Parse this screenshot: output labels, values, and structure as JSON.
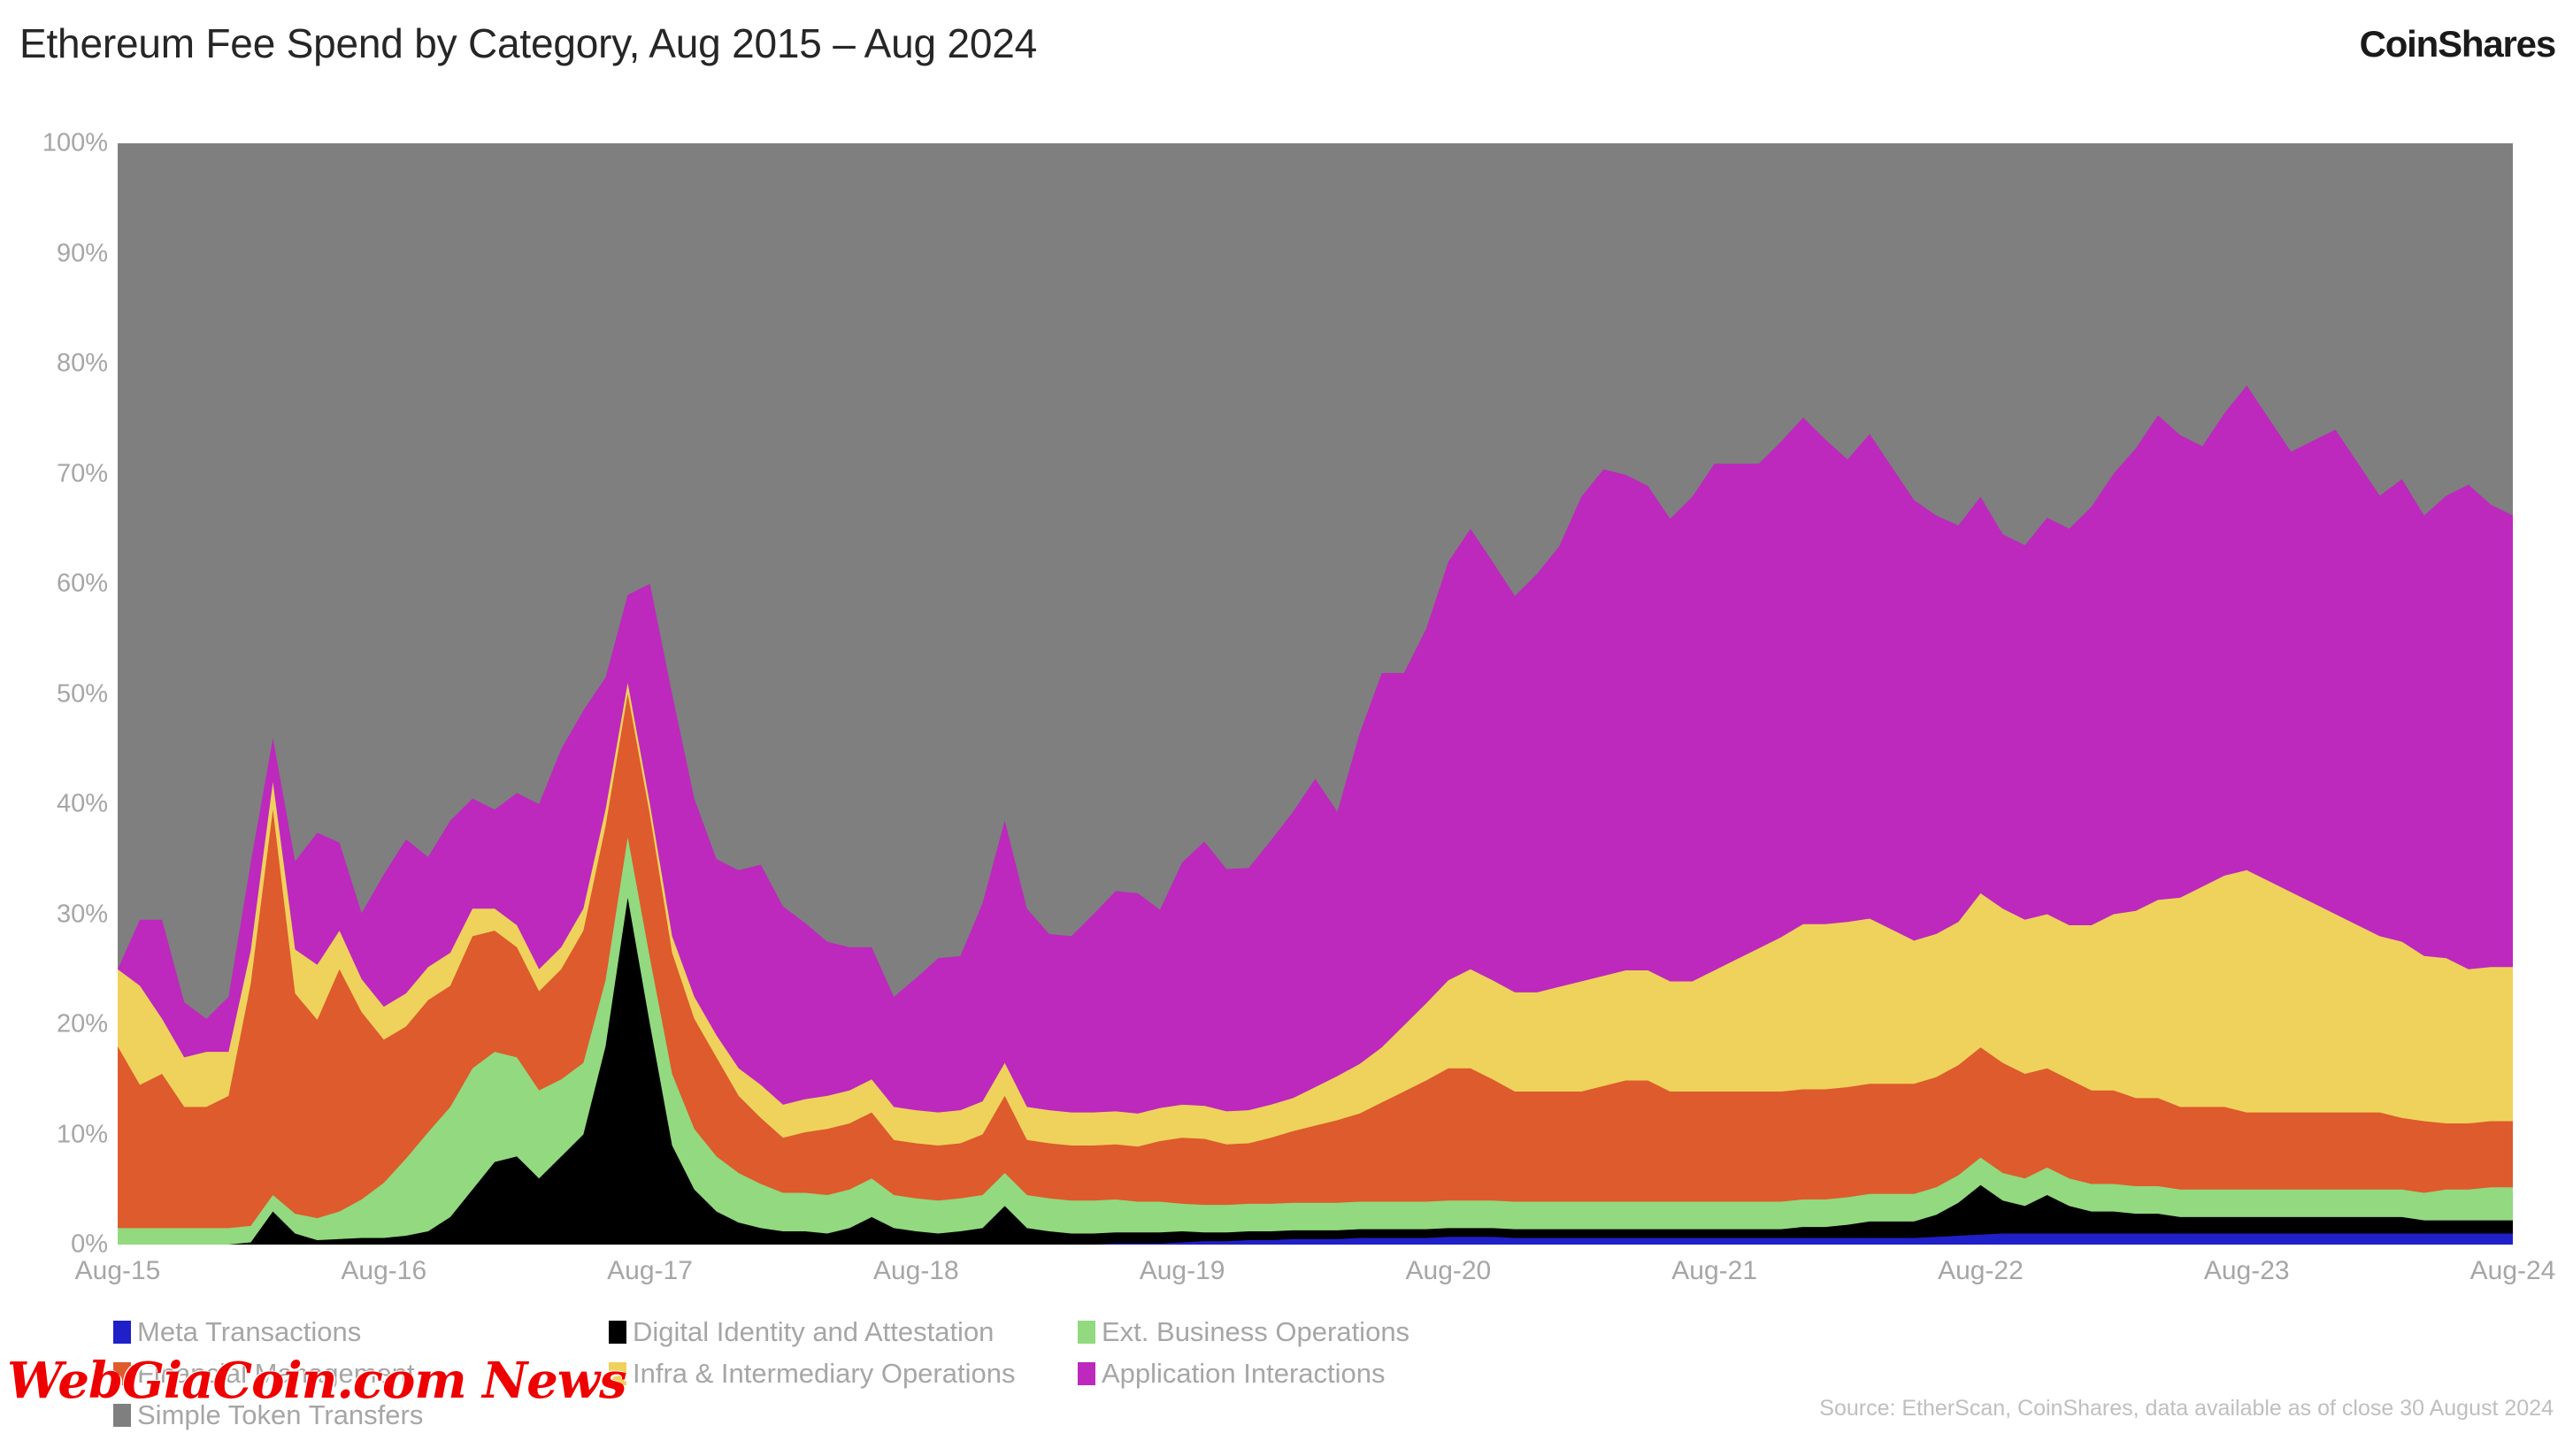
{
  "header": {
    "title": "Ethereum Fee Spend by Category, Aug 2015 – Aug 2024",
    "brand": "CoinShares"
  },
  "footer": {
    "source": "Source: EtherScan, CoinShares, data available as of close 30 August 2024",
    "watermark": "WebGiaCoin.com News"
  },
  "legend": {
    "items": [
      {
        "label": "Meta Transactions",
        "color": "#2020C8"
      },
      {
        "label": "Digital Identity and Attestation",
        "color": "#000000"
      },
      {
        "label": "Ext. Business Operations",
        "color": "#92D97F"
      },
      {
        "label": "Financial Management",
        "color": "#DD5B2C"
      },
      {
        "label": "Infra & Intermediary Operations",
        "color": "#EFD25C"
      },
      {
        "label": "Application Interactions",
        "color": "#BC29BC"
      },
      {
        "label": "Simple Token Transfers",
        "color": "#7F7F7F"
      }
    ]
  },
  "chart_data": {
    "type": "area",
    "stacked": true,
    "normalized": true,
    "title": "Ethereum Fee Spend by Category, Aug 2015 – Aug 2024",
    "xlabel": "",
    "ylabel": "",
    "ylim": [
      0,
      100
    ],
    "ytick_labels": [
      "100%",
      "90%",
      "80%",
      "70%",
      "60%",
      "50%",
      "40%",
      "30%",
      "20%",
      "10%",
      "0%"
    ],
    "ytick_values": [
      100,
      90,
      80,
      70,
      60,
      50,
      40,
      30,
      20,
      10,
      0
    ],
    "xtick_labels": [
      "Aug-15",
      "Aug-16",
      "Aug-17",
      "Aug-18",
      "Aug-19",
      "Aug-20",
      "Aug-21",
      "Aug-22",
      "Aug-23",
      "Aug-24"
    ],
    "grid": false,
    "legend_position": "bottom-left",
    "plot_background": "#7F7F7F",
    "x": [
      "Aug-15",
      "Sep-15",
      "Oct-15",
      "Nov-15",
      "Dec-15",
      "Jan-16",
      "Feb-16",
      "Mar-16",
      "Apr-16",
      "May-16",
      "Jun-16",
      "Jul-16",
      "Aug-16",
      "Sep-16",
      "Oct-16",
      "Nov-16",
      "Dec-16",
      "Jan-17",
      "Feb-17",
      "Mar-17",
      "Apr-17",
      "May-17",
      "Jun-17",
      "Jul-17",
      "Aug-17",
      "Sep-17",
      "Oct-17",
      "Nov-17",
      "Dec-17",
      "Jan-18",
      "Feb-18",
      "Mar-18",
      "Apr-18",
      "May-18",
      "Jun-18",
      "Jul-18",
      "Aug-18",
      "Sep-18",
      "Oct-18",
      "Nov-18",
      "Dec-18",
      "Jan-19",
      "Feb-19",
      "Mar-19",
      "Apr-19",
      "May-19",
      "Jun-19",
      "Jul-19",
      "Aug-19",
      "Sep-19",
      "Oct-19",
      "Nov-19",
      "Dec-19",
      "Jan-20",
      "Feb-20",
      "Mar-20",
      "Apr-20",
      "May-20",
      "Jun-20",
      "Jul-20",
      "Aug-20",
      "Sep-20",
      "Oct-20",
      "Nov-20",
      "Dec-20",
      "Jan-21",
      "Feb-21",
      "Mar-21",
      "Apr-21",
      "May-21",
      "Jun-21",
      "Jul-21",
      "Aug-21",
      "Sep-21",
      "Oct-21",
      "Nov-21",
      "Dec-21",
      "Jan-22",
      "Feb-22",
      "Mar-22",
      "Apr-22",
      "May-22",
      "Jun-22",
      "Jul-22",
      "Aug-22",
      "Sep-22",
      "Oct-22",
      "Nov-22",
      "Dec-22",
      "Jan-23",
      "Feb-23",
      "Mar-23",
      "Apr-23",
      "May-23",
      "Jun-23",
      "Jul-23",
      "Aug-23",
      "Sep-23",
      "Oct-23",
      "Nov-23",
      "Dec-23",
      "Jan-24",
      "Feb-24",
      "Mar-24",
      "Apr-24",
      "May-24",
      "Jun-24",
      "Jul-24",
      "Aug-24"
    ],
    "series": [
      {
        "name": "Meta Transactions",
        "color": "#2020C8",
        "values": [
          0,
          0,
          0,
          0,
          0,
          0,
          0,
          0,
          0,
          0,
          0,
          0,
          0,
          0,
          0,
          0,
          0,
          0,
          0,
          0,
          0,
          0,
          0,
          0,
          0,
          0,
          0,
          0,
          0,
          0,
          0,
          0,
          0,
          0,
          0,
          0,
          0,
          0,
          0,
          0,
          0,
          0,
          0,
          0,
          0,
          0.1,
          0.1,
          0.1,
          0.2,
          0.3,
          0.3,
          0.4,
          0.4,
          0.5,
          0.5,
          0.5,
          0.6,
          0.6,
          0.6,
          0.6,
          0.7,
          0.7,
          0.7,
          0.6,
          0.6,
          0.6,
          0.6,
          0.6,
          0.6,
          0.6,
          0.6,
          0.6,
          0.6,
          0.6,
          0.6,
          0.6,
          0.6,
          0.6,
          0.6,
          0.6,
          0.6,
          0.6,
          0.7,
          0.8,
          0.9,
          1.0,
          1.0,
          1.0,
          1.0,
          1.0,
          1.0,
          1.0,
          1.0,
          1.0,
          1.0,
          1.0,
          1.0,
          1.0,
          1.0,
          1.0,
          1.0,
          1.0,
          1.0,
          1.0,
          1.0,
          1.0,
          1.0,
          1.0,
          1.0
        ]
      },
      {
        "name": "Digital Identity and Attestation",
        "color": "#000000",
        "values": [
          0,
          0,
          0,
          0,
          0,
          0,
          0.2,
          3.0,
          1.0,
          0.4,
          0.5,
          0.6,
          0.6,
          0.8,
          1.2,
          2.5,
          5.0,
          7.5,
          8.0,
          6.0,
          8.0,
          10.0,
          18.0,
          31.5,
          20.0,
          9.0,
          5.0,
          3.0,
          2.0,
          1.5,
          1.2,
          1.2,
          1.0,
          1.5,
          2.5,
          1.5,
          1.2,
          1.0,
          1.2,
          1.5,
          3.5,
          1.5,
          1.2,
          1.0,
          1.0,
          1.0,
          1.0,
          1.0,
          1.0,
          0.8,
          0.8,
          0.8,
          0.8,
          0.8,
          0.8,
          0.8,
          0.8,
          0.8,
          0.8,
          0.8,
          0.8,
          0.8,
          0.8,
          0.8,
          0.8,
          0.8,
          0.8,
          0.8,
          0.8,
          0.8,
          0.8,
          0.8,
          0.8,
          0.8,
          0.8,
          0.8,
          1.0,
          1.0,
          1.2,
          1.5,
          1.5,
          1.5,
          2.0,
          3.0,
          4.5,
          3.0,
          2.5,
          3.5,
          2.5,
          2.0,
          2.0,
          1.8,
          1.8,
          1.5,
          1.5,
          1.5,
          1.5,
          1.5,
          1.5,
          1.5,
          1.5,
          1.5,
          1.5,
          1.5,
          1.2,
          1.2,
          1.2,
          1.2,
          1.2
        ]
      },
      {
        "name": "Ext. Business Operations",
        "color": "#92D97F",
        "values": [
          1.5,
          1.5,
          1.5,
          1.5,
          1.5,
          1.5,
          1.5,
          1.5,
          1.8,
          2.0,
          2.5,
          3.5,
          5.0,
          7.0,
          9.0,
          10.0,
          11.0,
          10.0,
          9.0,
          8.0,
          7.0,
          6.5,
          6.0,
          5.5,
          6.0,
          6.5,
          5.5,
          5.0,
          4.5,
          4.0,
          3.5,
          3.5,
          3.5,
          3.5,
          3.5,
          3.0,
          3.0,
          3.0,
          3.0,
          3.0,
          3.0,
          3.0,
          3.0,
          3.0,
          3.0,
          3.0,
          2.8,
          2.8,
          2.5,
          2.5,
          2.5,
          2.5,
          2.5,
          2.5,
          2.5,
          2.5,
          2.5,
          2.5,
          2.5,
          2.5,
          2.5,
          2.5,
          2.5,
          2.5,
          2.5,
          2.5,
          2.5,
          2.5,
          2.5,
          2.5,
          2.5,
          2.5,
          2.5,
          2.5,
          2.5,
          2.5,
          2.5,
          2.5,
          2.5,
          2.5,
          2.5,
          2.5,
          2.5,
          2.5,
          2.5,
          2.5,
          2.5,
          2.5,
          2.5,
          2.5,
          2.5,
          2.5,
          2.5,
          2.5,
          2.5,
          2.5,
          2.5,
          2.5,
          2.5,
          2.5,
          2.5,
          2.5,
          2.5,
          2.5,
          2.5,
          2.8,
          2.8,
          3.0,
          3.0
        ]
      },
      {
        "name": "Financial Management",
        "color": "#DD5B2C",
        "values": [
          16.5,
          13.0,
          14.0,
          11.0,
          11.0,
          12.0,
          22.0,
          35.0,
          20.0,
          18.0,
          22.0,
          17.0,
          13.0,
          12.0,
          12.0,
          11.0,
          12.0,
          11.0,
          10.0,
          9.0,
          10.0,
          12.0,
          14.0,
          13.0,
          13.0,
          11.0,
          10.0,
          9.0,
          7.0,
          6.0,
          5.0,
          5.5,
          6.0,
          6.0,
          6.0,
          5.0,
          5.0,
          5.0,
          5.0,
          5.5,
          7.0,
          5.0,
          5.0,
          5.0,
          5.0,
          5.0,
          5.0,
          5.5,
          6.0,
          6.0,
          5.5,
          5.5,
          6.0,
          6.5,
          7.0,
          7.5,
          8.0,
          9.0,
          10.0,
          11.0,
          12.0,
          12.0,
          11.0,
          10.0,
          10.0,
          10.0,
          10.0,
          10.5,
          11.0,
          11.0,
          10.0,
          10.0,
          10.0,
          10.0,
          10.0,
          10.0,
          10.0,
          10.0,
          10.0,
          10.0,
          10.0,
          10.0,
          10.0,
          10.0,
          10.0,
          10.0,
          9.5,
          9.0,
          9.0,
          8.5,
          8.5,
          8.0,
          8.0,
          7.5,
          7.5,
          7.5,
          7.0,
          7.0,
          7.0,
          7.0,
          7.0,
          7.0,
          7.0,
          6.5,
          6.5,
          6.0,
          6.0,
          6.0,
          6.0
        ]
      },
      {
        "name": "Infra & Intermediary Operations",
        "color": "#EFD25C",
        "values": [
          7.0,
          9.0,
          5.0,
          4.5,
          5.0,
          4.0,
          3.0,
          2.5,
          4.0,
          5.0,
          3.5,
          3.0,
          3.0,
          3.0,
          3.0,
          3.0,
          2.5,
          2.0,
          2.0,
          2.0,
          2.0,
          2.0,
          1.5,
          1.0,
          1.0,
          1.5,
          2.0,
          2.0,
          2.5,
          3.0,
          3.0,
          3.0,
          3.0,
          3.0,
          3.0,
          3.0,
          3.0,
          3.0,
          3.0,
          3.0,
          3.0,
          3.0,
          3.0,
          3.0,
          3.0,
          3.0,
          3.0,
          3.0,
          3.0,
          3.0,
          3.0,
          3.0,
          3.0,
          3.0,
          3.5,
          4.0,
          4.5,
          5.0,
          6.0,
          7.0,
          8.0,
          9.0,
          9.0,
          9.0,
          9.0,
          9.5,
          10.0,
          10.0,
          10.0,
          10.0,
          10.0,
          10.0,
          11.0,
          12.0,
          13.0,
          14.0,
          15.0,
          15.0,
          15.0,
          15.0,
          14.0,
          13.0,
          13.0,
          13.0,
          14.0,
          14.0,
          14.0,
          14.0,
          14.0,
          15.0,
          16.0,
          17.0,
          18.0,
          19.0,
          20.0,
          21.0,
          22.0,
          21.0,
          20.0,
          19.0,
          18.0,
          17.0,
          16.0,
          16.0,
          15.0,
          15.0,
          14.0,
          14.0,
          14.0
        ]
      },
      {
        "name": "Application Interactions",
        "color": "#BC29BC",
        "values": [
          0,
          6.0,
          9.0,
          5.0,
          3.0,
          5.0,
          8.0,
          4.0,
          8.0,
          12.0,
          8.0,
          6.0,
          12.0,
          14.0,
          10.0,
          12.0,
          10.0,
          9.0,
          12.0,
          15.0,
          18.0,
          18.0,
          12.0,
          8.0,
          20.0,
          22.0,
          18.0,
          16.0,
          18.0,
          20.0,
          18.0,
          16.0,
          14.0,
          13.0,
          12.0,
          10.0,
          12.0,
          14.0,
          14.0,
          18.0,
          22.0,
          18.0,
          16.0,
          16.0,
          18.0,
          20.0,
          20.0,
          18.0,
          22.0,
          24.0,
          22.0,
          22.0,
          24.0,
          26.0,
          28.0,
          24.0,
          30.0,
          34.0,
          32.0,
          34.0,
          38.0,
          40.0,
          38.0,
          36.0,
          38.0,
          40.0,
          44.0,
          46.0,
          45.0,
          44.0,
          42.0,
          44.0,
          46.0,
          45.0,
          44.0,
          45.0,
          46.0,
          44.0,
          42.0,
          44.0,
          42.0,
          40.0,
          38.0,
          36.0,
          36.0,
          34.0,
          34.0,
          36.0,
          36.0,
          38.0,
          40.0,
          42.0,
          44.0,
          42.0,
          40.0,
          42.0,
          44.0,
          42.0,
          40.0,
          42.0,
          44.0,
          42.0,
          40.0,
          42.0,
          40.0,
          42.0,
          44.0,
          42.0,
          41.0
        ]
      },
      {
        "name": "Simple Token Transfers",
        "color": "#7F7F7F",
        "values": [
          75.0,
          70.5,
          70.5,
          78.0,
          79.5,
          77.5,
          65.3,
          54.0,
          65.2,
          62.6,
          63.5,
          69.9,
          66.4,
          63.2,
          64.8,
          61.5,
          59.5,
          60.5,
          59.0,
          60.0,
          55.0,
          51.5,
          48.5,
          41.0,
          40.0,
          50.0,
          59.5,
          65.0,
          66.0,
          65.5,
          69.3,
          70.8,
          72.5,
          73.0,
          73.0,
          77.5,
          75.8,
          74.0,
          73.8,
          69.0,
          61.5,
          69.5,
          71.8,
          72.0,
          70.0,
          67.9,
          68.1,
          69.6,
          65.3,
          63.4,
          65.9,
          65.8,
          63.3,
          60.7,
          57.7,
          60.7,
          53.6,
          48.1,
          48.1,
          44.1,
          38.0,
          35.0,
          38.0,
          41.1,
          39.1,
          36.6,
          32.1,
          29.6,
          30.1,
          31.1,
          34.1,
          32.1,
          29.1,
          29.1,
          29.1,
          27.1,
          24.9,
          26.9,
          28.7,
          26.4,
          29.4,
          32.4,
          33.8,
          34.2,
          31.1,
          35.5,
          36.5,
          34.0,
          35.0,
          33.0,
          30.0,
          27.7,
          24.7,
          26.5,
          27.5,
          24.5,
          22.0,
          25.0,
          28.0,
          27.0,
          26.0,
          30.0,
          32.0,
          30.0,
          33.8,
          32.0,
          31.0,
          32.8,
          33.8
        ]
      }
    ]
  }
}
